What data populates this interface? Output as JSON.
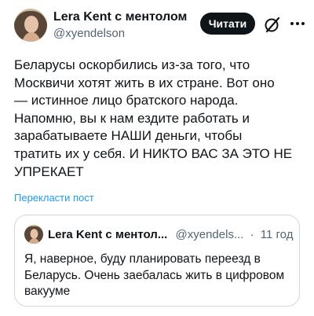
{
  "author": {
    "name": "Lera Kent с ментолом",
    "handle": "@xyendelson"
  },
  "actions": {
    "follow_label": "Читати"
  },
  "post": {
    "lines": [
      "Беларусы оскорбились из-за того, что",
      "Москвичи хотят жить в их стране. Вот оно",
      "— истинное лицо братского народа.",
      "Напомню, вы к нам ездите работать и",
      "зарабатываете НАШИ деньги, чтобы",
      "тратить их у себя. И НИКТО ВАС ЗА ЭТО НЕ",
      "УПРЕКАЕТ"
    ],
    "translate_link": "Перекласти пост"
  },
  "quote": {
    "name": "Lera Kent с ментол...",
    "handle": "@xyendels...",
    "separator": "·",
    "time": "11 год",
    "lines": [
      "Я, наверное, буду планировать переезд в",
      "Беларусь. Очень заебалась жить в цифровом",
      "вакууме"
    ]
  },
  "colors": {
    "text": "#0f1419",
    "secondary": "#536471",
    "link": "#1d9bf0",
    "button_bg": "#0f1419",
    "border": "#cfd9de"
  },
  "icons": {
    "grok": "grok-slash-icon",
    "more": "more-dots-icon"
  }
}
